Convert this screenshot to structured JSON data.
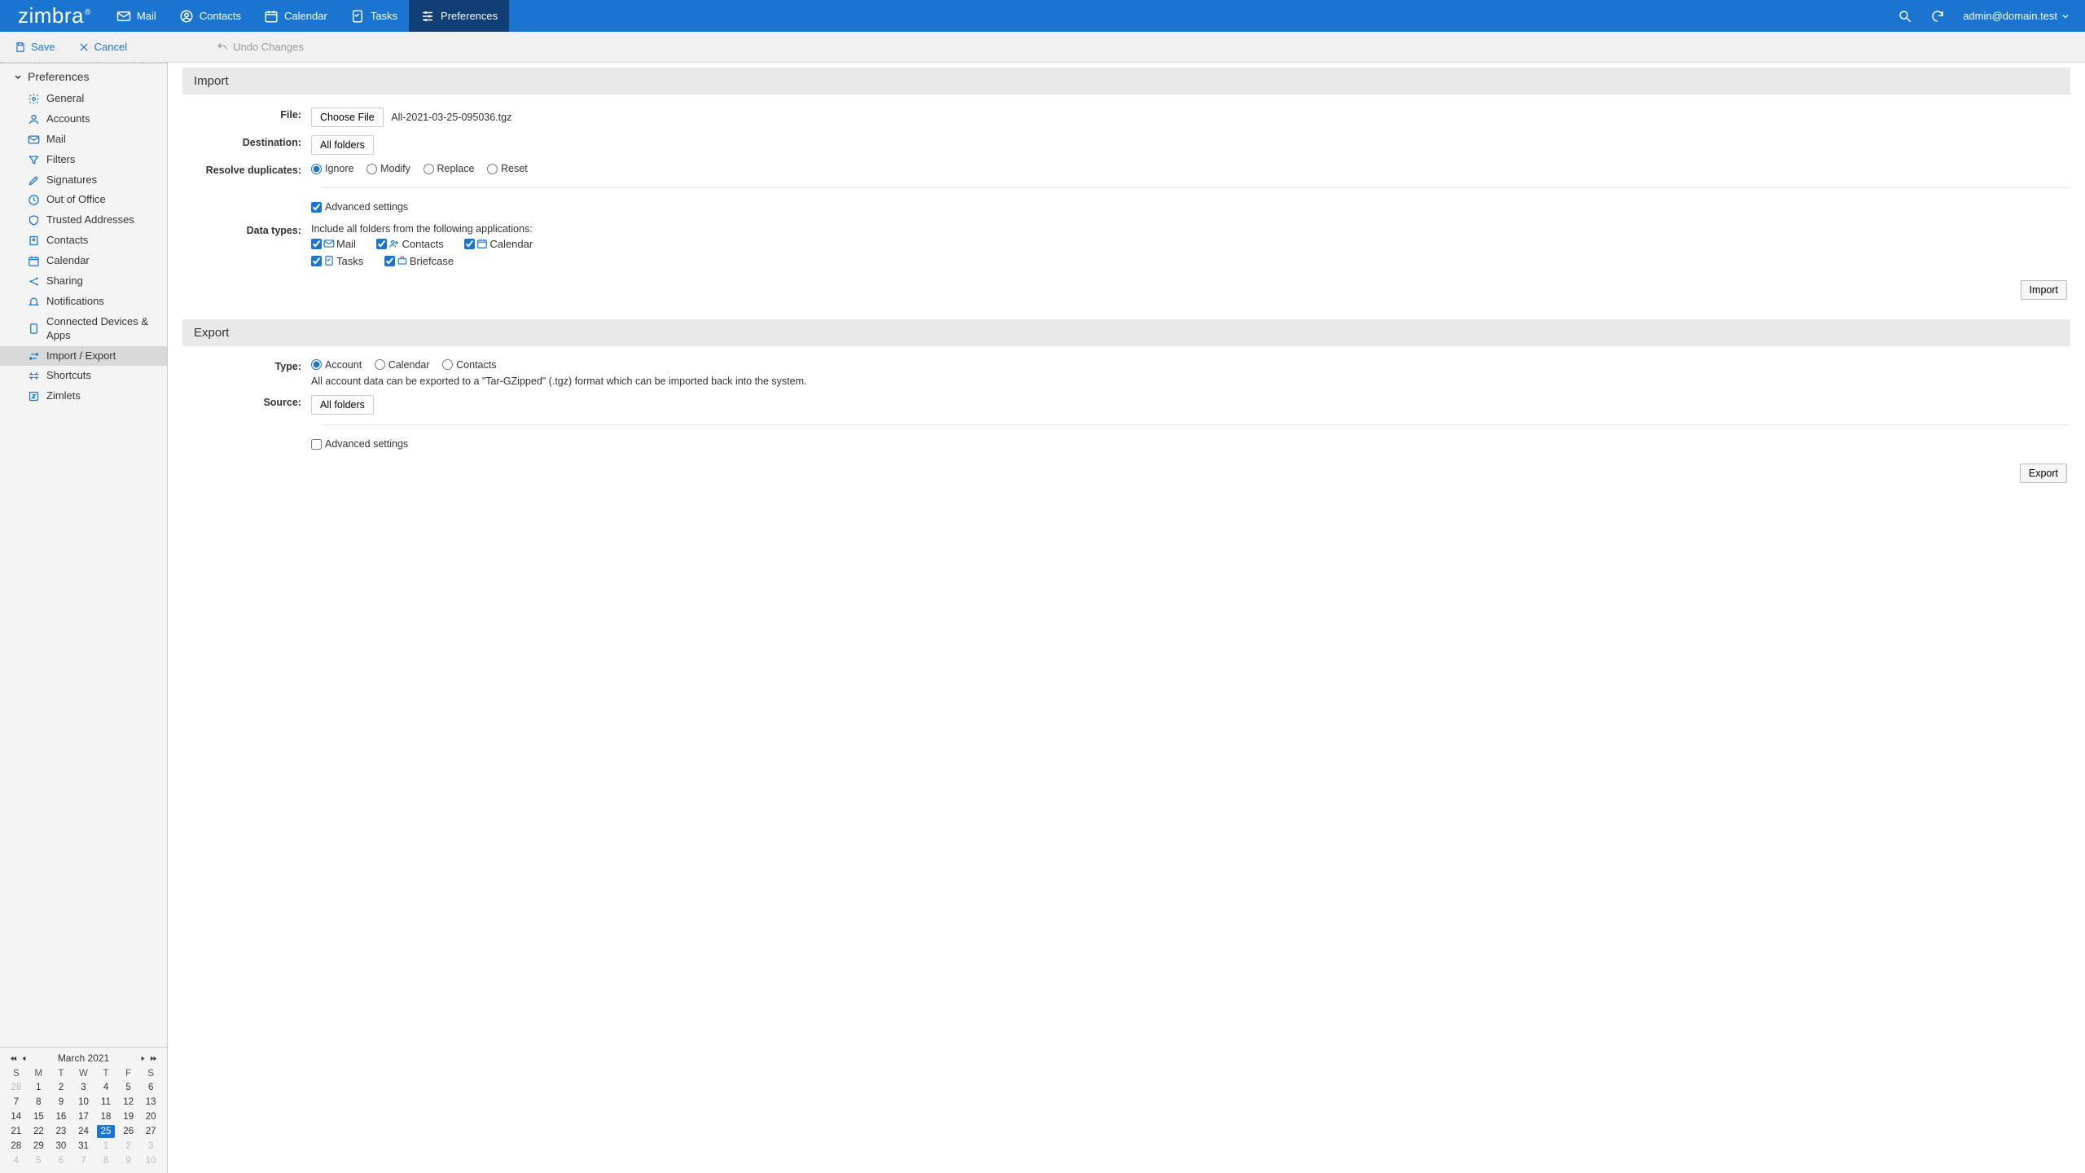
{
  "brand": "zimbra",
  "nav": {
    "mail": "Mail",
    "contacts": "Contacts",
    "calendar": "Calendar",
    "tasks": "Tasks",
    "preferences": "Preferences"
  },
  "account": "admin@domain.test",
  "toolbar": {
    "save": "Save",
    "cancel": "Cancel",
    "undo": "Undo Changes"
  },
  "sidebar": {
    "header": "Preferences",
    "items": {
      "general": "General",
      "accounts": "Accounts",
      "mail": "Mail",
      "filters": "Filters",
      "signatures": "Signatures",
      "out_of_office": "Out of Office",
      "trusted": "Trusted Addresses",
      "contacts": "Contacts",
      "calendar": "Calendar",
      "sharing": "Sharing",
      "notifications": "Notifications",
      "devices": "Connected Devices & Apps",
      "import_export": "Import / Export",
      "shortcuts": "Shortcuts",
      "zimlets": "Zimlets"
    }
  },
  "calendar": {
    "title": "March 2021",
    "dow": [
      "S",
      "M",
      "T",
      "W",
      "T",
      "F",
      "S"
    ],
    "weeks": [
      [
        {
          "n": 28,
          "o": true
        },
        {
          "n": 1
        },
        {
          "n": 2
        },
        {
          "n": 3
        },
        {
          "n": 4
        },
        {
          "n": 5
        },
        {
          "n": 6
        }
      ],
      [
        {
          "n": 7
        },
        {
          "n": 8
        },
        {
          "n": 9
        },
        {
          "n": 10
        },
        {
          "n": 11
        },
        {
          "n": 12
        },
        {
          "n": 13
        }
      ],
      [
        {
          "n": 14
        },
        {
          "n": 15
        },
        {
          "n": 16
        },
        {
          "n": 17
        },
        {
          "n": 18
        },
        {
          "n": 19
        },
        {
          "n": 20
        }
      ],
      [
        {
          "n": 21
        },
        {
          "n": 22
        },
        {
          "n": 23
        },
        {
          "n": 24
        },
        {
          "n": 25,
          "today": true
        },
        {
          "n": 26
        },
        {
          "n": 27
        }
      ],
      [
        {
          "n": 28
        },
        {
          "n": 29
        },
        {
          "n": 30
        },
        {
          "n": 31
        },
        {
          "n": 1,
          "o": true
        },
        {
          "n": 2,
          "o": true
        },
        {
          "n": 3,
          "o": true
        }
      ],
      [
        {
          "n": 4,
          "o": true
        },
        {
          "n": 5,
          "o": true
        },
        {
          "n": 6,
          "o": true
        },
        {
          "n": 7,
          "o": true
        },
        {
          "n": 8,
          "o": true
        },
        {
          "n": 9,
          "o": true
        },
        {
          "n": 10,
          "o": true
        }
      ]
    ]
  },
  "import": {
    "title": "Import",
    "file_label": "File:",
    "choose_btn": "Choose File",
    "filename": "All-2021-03-25-095036.tgz",
    "dest_label": "Destination:",
    "dest_btn": "All folders",
    "dup_label": "Resolve duplicates:",
    "dup_opts": {
      "ignore": "Ignore",
      "modify": "Modify",
      "replace": "Replace",
      "reset": "Reset"
    },
    "adv_label": "Advanced settings",
    "types_label": "Data types:",
    "types_hint": "Include all folders from the following applications:",
    "apps": {
      "mail": "Mail",
      "contacts": "Contacts",
      "calendar": "Calendar",
      "tasks": "Tasks",
      "briefcase": "Briefcase"
    },
    "btn": "Import"
  },
  "export": {
    "title": "Export",
    "type_label": "Type:",
    "type_opts": {
      "account": "Account",
      "calendar": "Calendar",
      "contacts": "Contacts"
    },
    "info": "All account data can be exported to a \"Tar-GZipped\" (.tgz) format which can be imported back into the system.",
    "source_label": "Source:",
    "source_btn": "All folders",
    "adv_label": "Advanced settings",
    "btn": "Export"
  }
}
